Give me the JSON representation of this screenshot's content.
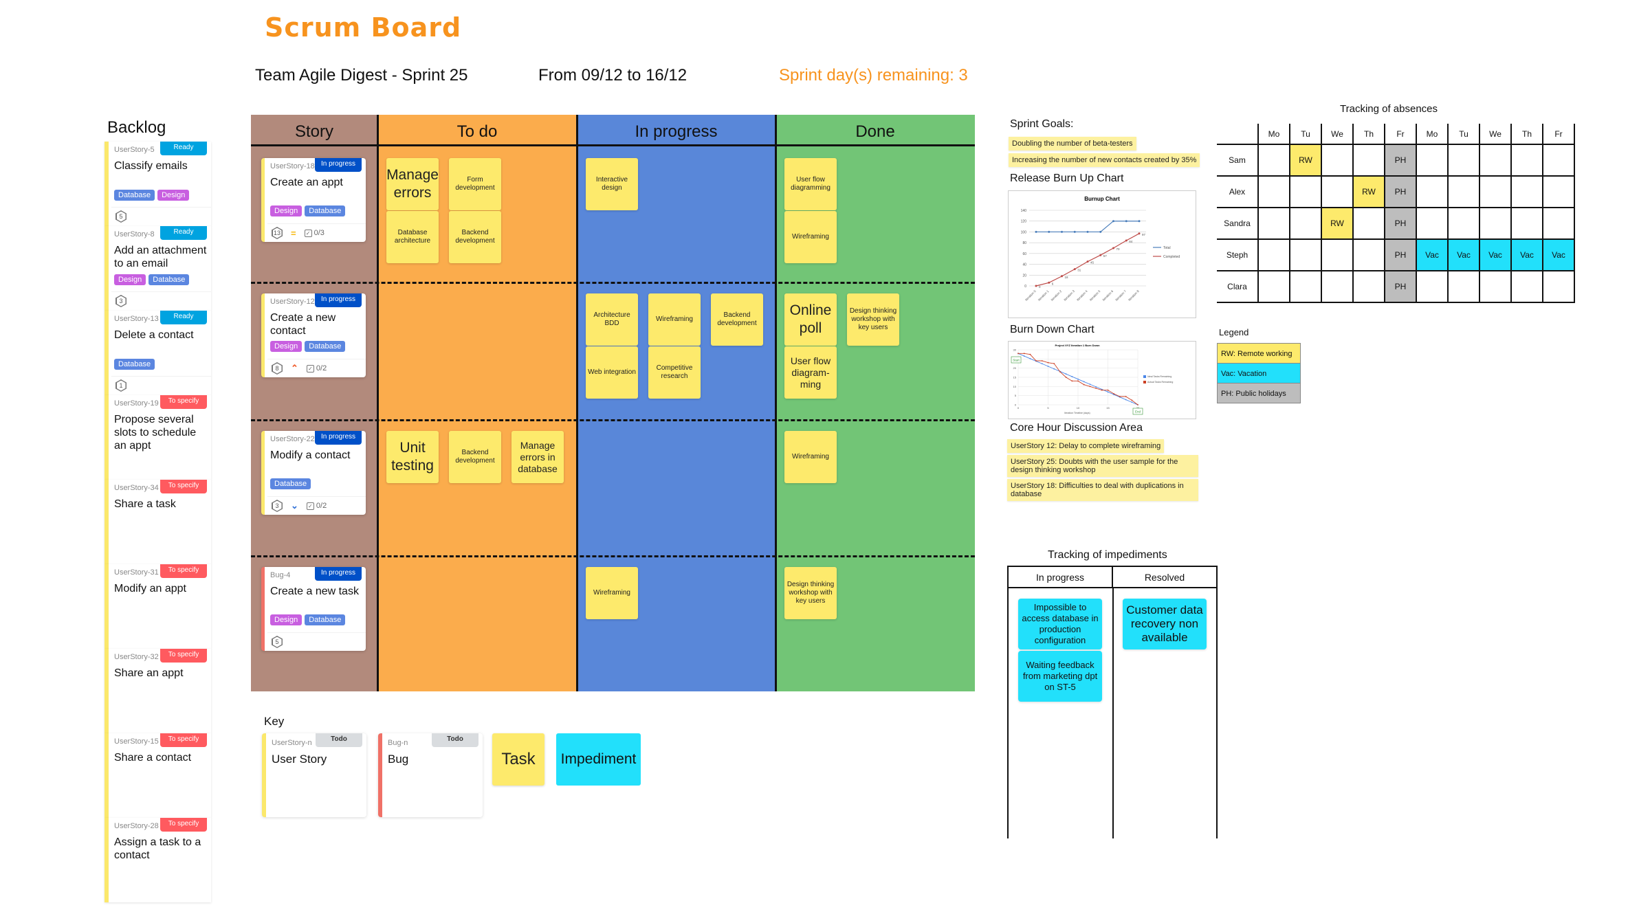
{
  "header": {
    "title": "Scrum Board",
    "team_sprint": "Team Agile Digest - Sprint 25",
    "dates": "From 09/12 to 16/12",
    "remaining": "Sprint day(s) remaining: 3"
  },
  "backlog": {
    "title": "Backlog",
    "items": [
      {
        "id": "UserStory-5",
        "status": "Ready",
        "title": "Classify emails",
        "tags": [
          "Database",
          "Design"
        ],
        "points": "5"
      },
      {
        "id": "UserStory-8",
        "status": "Ready",
        "title": "Add an attachment to an email",
        "tags": [
          "Design",
          "Database"
        ],
        "points": "3"
      },
      {
        "id": "UserStory-13",
        "status": "Ready",
        "title": "Delete a contact",
        "tags": [
          "Database"
        ],
        "points": "1"
      },
      {
        "id": "UserStory-19",
        "status": "To specify",
        "title": "Propose several slots to schedule an appt",
        "tags": [],
        "points": null
      },
      {
        "id": "UserStory-34",
        "status": "To specify",
        "title": "Share a task",
        "tags": [],
        "points": null
      },
      {
        "id": "UserStory-31",
        "status": "To specify",
        "title": "Modify an appt",
        "tags": [],
        "points": null
      },
      {
        "id": "UserStory-32",
        "status": "To specify",
        "title": "Share an appt",
        "tags": [],
        "points": null
      },
      {
        "id": "UserStory-15",
        "status": "To specify",
        "title": "Share a contact",
        "tags": [],
        "points": null
      },
      {
        "id": "UserStory-28",
        "status": "To specify",
        "title": "Assign a task to a contact",
        "tags": [],
        "points": null
      }
    ]
  },
  "board": {
    "columns": [
      {
        "label": "Story",
        "color": "#b28a7c"
      },
      {
        "label": "To do",
        "color": "#fbac4c"
      },
      {
        "label": "In progress",
        "color": "#5987d9"
      },
      {
        "label": "Done",
        "color": "#72c576"
      }
    ],
    "rows": [
      {
        "story": {
          "id": "UserStory-18",
          "status": "In progress",
          "title": "Create an appt",
          "tags": [
            "Design",
            "Database"
          ],
          "points": "13",
          "priority": "medium",
          "priority_icon": "=",
          "checklist": "0/3",
          "type": "story"
        },
        "todo": [
          {
            "text": "Manage errors",
            "size": "big"
          },
          {
            "text": "Form development",
            "size": "small"
          },
          {
            "text": "Database architecture",
            "size": "small"
          },
          {
            "text": "Backend development",
            "size": "small"
          }
        ],
        "inprogress": [
          {
            "text": "Interactive design",
            "size": "small"
          }
        ],
        "done": [
          {
            "text": "User flow diagramming",
            "size": "small"
          },
          {
            "text": "Wireframing",
            "size": "small"
          }
        ]
      },
      {
        "story": {
          "id": "UserStory-12",
          "status": "In progress",
          "title": "Create a new contact",
          "tags": [
            "Design",
            "Database"
          ],
          "points": "8",
          "priority": "high",
          "priority_icon": "⌃",
          "checklist": "0/2",
          "type": "story"
        },
        "todo": [],
        "inprogress": [
          {
            "text": "Architecture BDD",
            "size": "small"
          },
          {
            "text": "Wireframing",
            "size": "small"
          },
          {
            "text": "Backend development",
            "size": "small"
          },
          {
            "text": "Web integration",
            "size": "small"
          },
          {
            "text": "Competitive research",
            "size": "small"
          }
        ],
        "done": [
          {
            "text": "Online poll",
            "size": "big"
          },
          {
            "text": "Design thinking workshop with key users",
            "size": "small"
          },
          {
            "text": "User flow diagram-ming",
            "size": "mid"
          }
        ]
      },
      {
        "story": {
          "id": "UserStory-22",
          "status": "In progress",
          "title": "Modify a contact",
          "tags": [
            "Database"
          ],
          "points": "3",
          "priority": "low",
          "priority_icon": "⌄",
          "checklist": "0/2",
          "type": "story"
        },
        "todo": [
          {
            "text": "Unit testing",
            "size": "big"
          },
          {
            "text": "Backend development",
            "size": "small"
          },
          {
            "text": "Manage errors in database",
            "size": "mid"
          }
        ],
        "inprogress": [],
        "done": [
          {
            "text": "Wireframing",
            "size": "small"
          }
        ]
      },
      {
        "story": {
          "id": "Bug-4",
          "status": "In progress",
          "title": "Create a new task",
          "tags": [
            "Design",
            "Database"
          ],
          "points": "5",
          "priority": null,
          "priority_icon": null,
          "checklist": null,
          "type": "bug"
        },
        "todo": [],
        "inprogress": [
          {
            "text": "Wireframing",
            "size": "small"
          }
        ],
        "done": [
          {
            "text": "Design thinking workshop with key users",
            "size": "small"
          }
        ]
      }
    ]
  },
  "key": {
    "title": "Key",
    "user_story": {
      "id": "UserStory-n",
      "status": "Todo",
      "title": "User Story"
    },
    "bug": {
      "id": "Bug-n",
      "status": "Todo",
      "title": "Bug"
    },
    "task": "Task",
    "impediment": "Impediment"
  },
  "sprint_goals": {
    "title": "Sprint Goals:",
    "items": [
      "Doubling the number of beta-testers",
      "Increasing the number of new contacts created by 35%"
    ]
  },
  "burnup": {
    "section_title": "Release Burn Up Chart",
    "chart_data": {
      "type": "line",
      "title": "Burnup Chart",
      "categories": [
        "Iteration 0",
        "Iteration 1",
        "Iteration 2",
        "Iteration 3",
        "Iteration 4",
        "Iteration 5",
        "Iteration 6",
        "Iteration 7",
        "Iteration 8"
      ],
      "series": [
        {
          "name": "Total",
          "color": "#4a7ebb",
          "values": [
            100,
            100,
            100,
            100,
            100,
            100,
            120,
            120,
            120
          ]
        },
        {
          "name": "Completed",
          "color": "#be4b48",
          "values": [
            0,
            6,
            18,
            31,
            45,
            57,
            70,
            84,
            97
          ]
        }
      ],
      "ylim": [
        0,
        140
      ],
      "yticks": [
        0,
        20,
        40,
        60,
        80,
        100,
        120,
        140
      ],
      "legend": "right",
      "grid": true
    }
  },
  "burndown": {
    "section_title": "Burn Down Chart",
    "chart_data": {
      "type": "line",
      "title": "Project XYZ Iteration 1 Burn Down",
      "xlabel": "Iteration Timeline (days)",
      "x": [
        0,
        1,
        2,
        3,
        4,
        5,
        6,
        7,
        8,
        9,
        10,
        11,
        12,
        13,
        14,
        15,
        16,
        17,
        18,
        19,
        20
      ],
      "series": [
        {
          "name": "Ideal Tasks Remaining",
          "color": "#4a86e8",
          "values": [
            28,
            26.6,
            25.2,
            23.8,
            22.4,
            21,
            19.6,
            18.2,
            16.8,
            15.4,
            14,
            12.6,
            11.2,
            9.8,
            8.4,
            7,
            5.6,
            4.2,
            2.8,
            1.4,
            0
          ]
        },
        {
          "name": "Actual Tasks Remaining",
          "color": "#cc4125",
          "values": [
            28,
            28,
            27.5,
            24,
            24,
            23,
            22.5,
            18,
            15,
            13,
            13,
            11,
            10,
            9,
            8,
            8,
            6,
            4.5,
            4.5,
            2.5,
            0
          ]
        }
      ],
      "xlim": [
        0,
        20
      ],
      "ylim": [
        0,
        30
      ],
      "xticks": [
        0,
        5,
        10,
        15,
        20
      ],
      "yticks": [
        0,
        5,
        10,
        15,
        20,
        25,
        30
      ],
      "annotations": [
        "Start",
        "End"
      ],
      "legend": "right",
      "grid": true
    }
  },
  "discussion": {
    "title": "Core Hour Discussion Area",
    "items": [
      "UserStory 12: Delay to complete wireframing",
      "UserStory 25: Doubts with the user sample for the design thinking workshop",
      "UserStory 18: Difficulties to deal with duplications in database"
    ]
  },
  "absences": {
    "title": "Tracking of absences",
    "days": [
      "Mo",
      "Tu",
      "We",
      "Th",
      "Fr",
      "Mo",
      "Tu",
      "We",
      "Th",
      "Fr"
    ],
    "people": [
      {
        "name": "Sam",
        "cells": [
          "",
          "RW",
          "",
          "",
          "PH",
          "",
          "",
          "",
          "",
          ""
        ]
      },
      {
        "name": "Alex",
        "cells": [
          "",
          "",
          "",
          "RW",
          "PH",
          "",
          "",
          "",
          "",
          ""
        ]
      },
      {
        "name": "Sandra",
        "cells": [
          "",
          "",
          "RW",
          "",
          "PH",
          "",
          "",
          "",
          "",
          ""
        ]
      },
      {
        "name": "Steph",
        "cells": [
          "",
          "",
          "",
          "",
          "PH",
          "Vac",
          "Vac",
          "Vac",
          "Vac",
          "Vac"
        ]
      },
      {
        "name": "Clara",
        "cells": [
          "",
          "",
          "",
          "",
          "PH",
          "",
          "",
          "",
          "",
          ""
        ]
      }
    ],
    "legend_title": "Legend",
    "legend": [
      {
        "code": "RW",
        "label": "RW: Remote working",
        "color": "#fdea6c"
      },
      {
        "code": "Vac",
        "label": "Vac: Vacation",
        "color": "#22e0fb"
      },
      {
        "code": "PH",
        "label": "PH: Public holidays",
        "color": "#bdbdbd"
      }
    ]
  },
  "impediments": {
    "title": "Tracking of impediments",
    "columns": [
      "In progress",
      "Resolved"
    ],
    "in_progress": [
      "Impossible to access database in production configuration",
      "Waiting feedback from marketing dpt on ST-5"
    ],
    "resolved": [
      "Customer data recovery non available"
    ]
  }
}
